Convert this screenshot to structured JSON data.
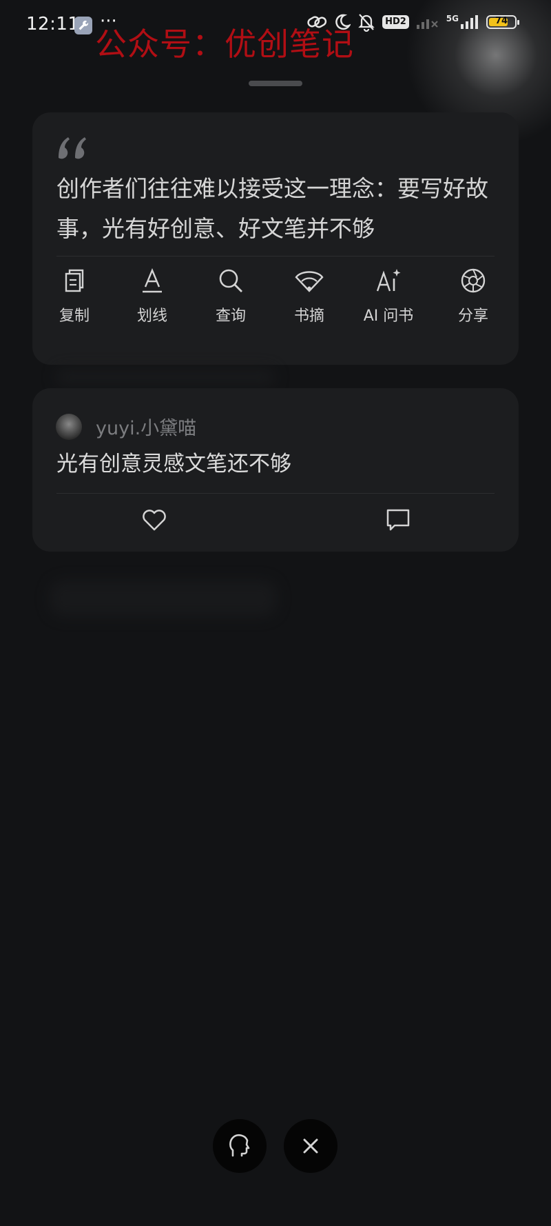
{
  "status_bar": {
    "time": "12:11",
    "dots": "···",
    "hd_label": "HD2",
    "network_label": "5G",
    "battery_level": "74",
    "battery_percent": 74
  },
  "watermark": "公众号：优创笔记",
  "quote_card": {
    "text": "创作者们往往难以接受这一理念：要写好故事，光有好创意、好文笔并不够",
    "actions": [
      {
        "label": "复制",
        "icon": "copy-icon"
      },
      {
        "label": "划线",
        "icon": "underline-icon"
      },
      {
        "label": "查询",
        "icon": "search-icon"
      },
      {
        "label": "书摘",
        "icon": "fan-icon"
      },
      {
        "label": "AI 问书",
        "icon": "ai-sparkle-icon"
      },
      {
        "label": "分享",
        "icon": "aperture-icon"
      }
    ]
  },
  "comment": {
    "username": "yuyi.小黛喵",
    "text": "光有创意灵感文笔还不够",
    "like_icon": "heart-icon",
    "reply_icon": "comment-bubble-icon"
  },
  "bottom_bar": {
    "left_icon": "head-profile-icon",
    "right_icon": "close-icon"
  },
  "colors": {
    "background": "#121315",
    "card": "#1c1d1f",
    "watermark": "#b10e14",
    "battery": "#f2c21b"
  }
}
